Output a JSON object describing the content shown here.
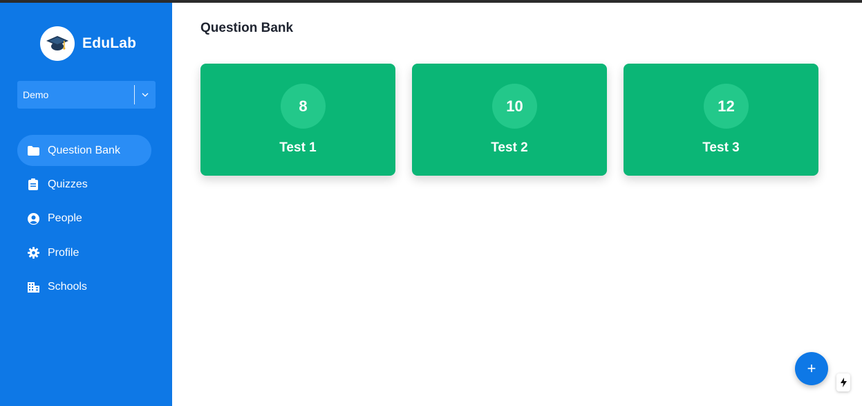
{
  "app": {
    "name": "EduLab",
    "logo_icon": "graduation-cap-icon",
    "brand_color": "#0e78e6",
    "card_color": "#0bb676"
  },
  "school_select": {
    "value": "Demo"
  },
  "sidebar": {
    "items": [
      {
        "label": "Question Bank",
        "icon": "folder-icon",
        "active": true
      },
      {
        "label": "Quizzes",
        "icon": "clipboard-icon",
        "active": false
      },
      {
        "label": "People",
        "icon": "user-circle-icon",
        "active": false
      },
      {
        "label": "Profile",
        "icon": "gear-icon",
        "active": false
      },
      {
        "label": "Schools",
        "icon": "building-icon",
        "active": false
      }
    ]
  },
  "main": {
    "title": "Question Bank",
    "cards": [
      {
        "count": "8",
        "title": "Test 1"
      },
      {
        "count": "10",
        "title": "Test 2"
      },
      {
        "count": "12",
        "title": "Test 3"
      }
    ],
    "fab_label": "+"
  }
}
